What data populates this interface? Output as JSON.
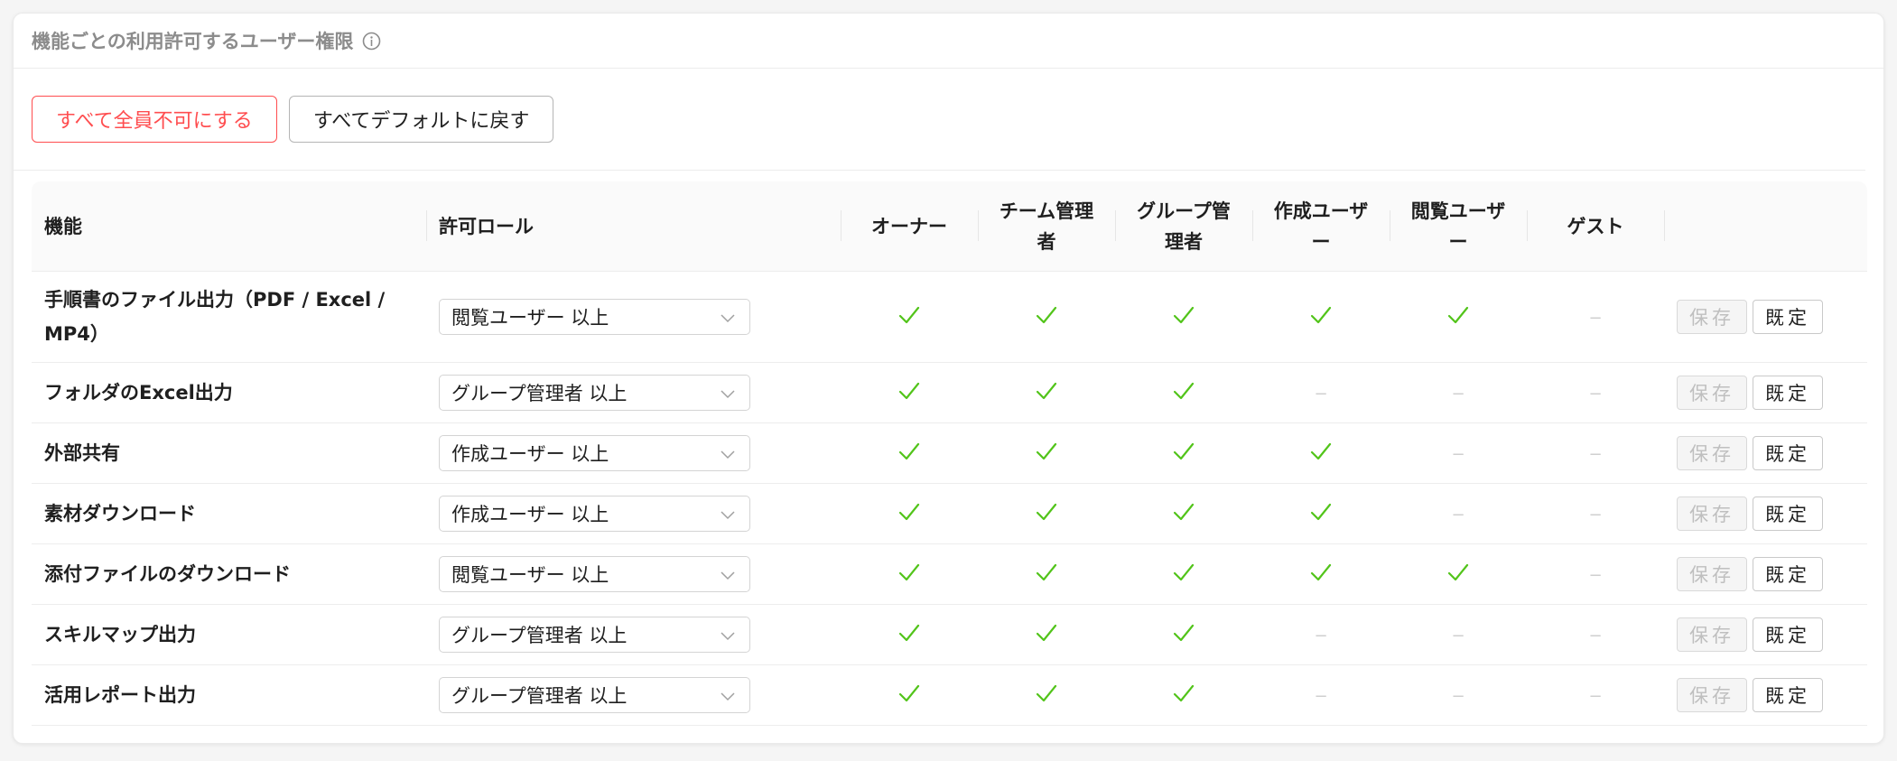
{
  "card": {
    "title": "機能ごとの利用許可するユーザー権限",
    "info_icon": "info-circle-icon"
  },
  "actions": {
    "deny_all_label": "すべて全員不可にする",
    "reset_all_label": "すべてデフォルトに戻す"
  },
  "table": {
    "headers": {
      "feature": "機能",
      "role": "許可ロール",
      "owner": "オーナー",
      "team_admin_1": "チーム管理",
      "team_admin_2": "者",
      "group_admin_1": "グループ管",
      "group_admin_2": "理者",
      "creator_1": "作成ユーザ",
      "creator_2": "ー",
      "viewer_1": "閲覧ユーザ",
      "viewer_2": "ー",
      "guest": "ゲスト"
    },
    "save_label": "保存",
    "default_label": "既定",
    "dash": "−",
    "rows": [
      {
        "feature_1": "手順書のファイル出力（PDF / Excel /",
        "feature_2": "MP4）",
        "role": "閲覧ユーザー 以上",
        "perms": [
          true,
          true,
          true,
          true,
          true,
          false
        ]
      },
      {
        "feature_1": "フォルダのExcel出力",
        "feature_2": "",
        "role": "グループ管理者 以上",
        "perms": [
          true,
          true,
          true,
          false,
          false,
          false
        ]
      },
      {
        "feature_1": "外部共有",
        "feature_2": "",
        "role": "作成ユーザー 以上",
        "perms": [
          true,
          true,
          true,
          true,
          false,
          false
        ]
      },
      {
        "feature_1": "素材ダウンロード",
        "feature_2": "",
        "role": "作成ユーザー 以上",
        "perms": [
          true,
          true,
          true,
          true,
          false,
          false
        ]
      },
      {
        "feature_1": "添付ファイルのダウンロード",
        "feature_2": "",
        "role": "閲覧ユーザー 以上",
        "perms": [
          true,
          true,
          true,
          true,
          true,
          false
        ]
      },
      {
        "feature_1": "スキルマップ出力",
        "feature_2": "",
        "role": "グループ管理者 以上",
        "perms": [
          true,
          true,
          true,
          false,
          false,
          false
        ]
      },
      {
        "feature_1": "活用レポート出力",
        "feature_2": "",
        "role": "グループ管理者 以上",
        "perms": [
          true,
          true,
          true,
          false,
          false,
          false
        ]
      }
    ]
  },
  "colors": {
    "check": "#52c41a",
    "danger": "#ff4d4f"
  }
}
